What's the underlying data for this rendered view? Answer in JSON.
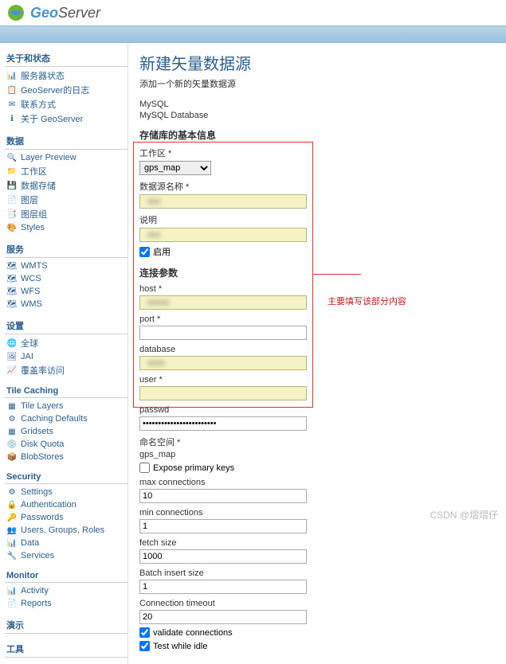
{
  "header": {
    "logo1": "Geo",
    "logo2": "Server"
  },
  "sidebar": {
    "sections": [
      {
        "title": "关于和状态",
        "items": [
          {
            "icon": "📊",
            "label": "服务器状态"
          },
          {
            "icon": "📋",
            "label": "GeoServer的日志"
          },
          {
            "icon": "✉",
            "label": "联系方式"
          },
          {
            "icon": "ℹ",
            "label": "关于 GeoServer"
          }
        ]
      },
      {
        "title": "数据",
        "items": [
          {
            "icon": "🔍",
            "label": "Layer Preview"
          },
          {
            "icon": "📁",
            "label": "工作区"
          },
          {
            "icon": "💾",
            "label": "数据存储"
          },
          {
            "icon": "📄",
            "label": "图层"
          },
          {
            "icon": "📑",
            "label": "图层组"
          },
          {
            "icon": "🎨",
            "label": "Styles"
          }
        ]
      },
      {
        "title": "服务",
        "items": [
          {
            "icon": "🗺",
            "label": "WMTS"
          },
          {
            "icon": "🗺",
            "label": "WCS"
          },
          {
            "icon": "🗺",
            "label": "WFS"
          },
          {
            "icon": "🗺",
            "label": "WMS"
          }
        ]
      },
      {
        "title": "设置",
        "items": [
          {
            "icon": "🌐",
            "label": "全球"
          },
          {
            "icon": "🖼",
            "label": "JAI"
          },
          {
            "icon": "📈",
            "label": "覆盖率访问"
          }
        ]
      },
      {
        "title": "Tile Caching",
        "items": [
          {
            "icon": "▦",
            "label": "Tile Layers"
          },
          {
            "icon": "⚙",
            "label": "Caching Defaults"
          },
          {
            "icon": "▦",
            "label": "Gridsets"
          },
          {
            "icon": "💿",
            "label": "Disk Quota"
          },
          {
            "icon": "📦",
            "label": "BlobStores"
          }
        ]
      },
      {
        "title": "Security",
        "items": [
          {
            "icon": "⚙",
            "label": "Settings"
          },
          {
            "icon": "🔒",
            "label": "Authentication"
          },
          {
            "icon": "🔑",
            "label": "Passwords"
          },
          {
            "icon": "👥",
            "label": "Users, Groups, Roles"
          },
          {
            "icon": "📊",
            "label": "Data"
          },
          {
            "icon": "🔧",
            "label": "Services"
          }
        ]
      },
      {
        "title": "Monitor",
        "items": [
          {
            "icon": "📊",
            "label": "Activity"
          },
          {
            "icon": "📄",
            "label": "Reports"
          }
        ]
      },
      {
        "title": "演示",
        "items": []
      },
      {
        "title": "工具",
        "items": []
      }
    ]
  },
  "main": {
    "title": "新建矢量数据源",
    "subtitle": "添加一个新的矢量数据源",
    "dbtype1": "MySQL",
    "dbtype2": "MySQL Database",
    "basic_header": "存储库的基本信息",
    "workspace_label": "工作区 *",
    "workspace_value": "gps_map",
    "dsname_label": "数据源名称 *",
    "desc_label": "说明",
    "enable_label": "启用",
    "conn_header": "连接参数",
    "host_label": "host *",
    "port_label": "port *",
    "database_label": "database",
    "user_label": "user *",
    "passwd_label": "passwd",
    "passwd_value": "••••••••••••••••••••••••",
    "ns_label": "命名空间 *",
    "ns_value": "gps_map",
    "expose_label": "Expose primary keys",
    "maxconn_label": "max connections",
    "maxconn_value": "10",
    "minconn_label": "min connections",
    "minconn_value": "1",
    "fetch_label": "fetch size",
    "fetch_value": "1000",
    "batch_label": "Batch insert size",
    "batch_value": "1",
    "timeout_label": "Connection timeout",
    "timeout_value": "20",
    "validate_label": "validate connections",
    "testidle_label": "Test while idle"
  },
  "annotation": "主要填写该部分内容",
  "watermark": "CSDN @熠熠仔"
}
